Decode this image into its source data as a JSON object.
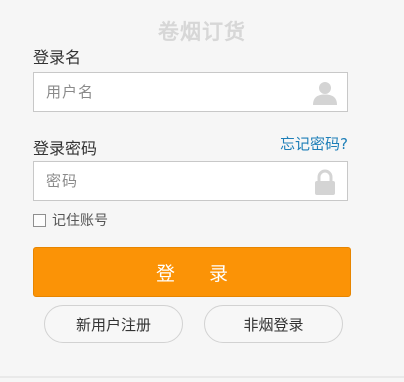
{
  "title": "卷烟订货",
  "username": {
    "label": "登录名",
    "placeholder": "用户名",
    "value": "",
    "icon": "user-icon"
  },
  "password": {
    "label": "登录密码",
    "placeholder": "密码",
    "value": "",
    "icon": "lock-icon",
    "forgot_link": "忘记密码?"
  },
  "remember": {
    "label": "记住账号",
    "checked": false
  },
  "login_button": "登 录",
  "register_button": "新用户注册",
  "non_smoke_button": "非烟登录",
  "colors": {
    "accent": "#fb9306",
    "link": "#1e7fb8",
    "title": "#d7d7d7"
  }
}
